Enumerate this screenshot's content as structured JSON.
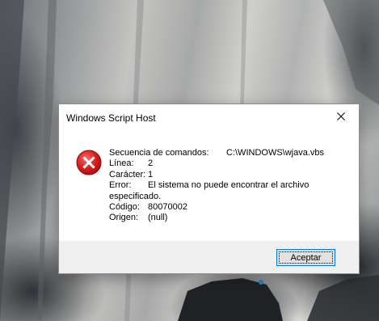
{
  "dialog": {
    "title": "Windows Script Host",
    "close_icon": "close-icon",
    "icon": "error-icon",
    "accent_color": "#0078d7",
    "error_color": "#e81123",
    "fields": {
      "script_label": "Secuencia de comandos:",
      "script_value": "C:\\WINDOWS\\wjava.vbs",
      "line_label": "Línea:",
      "line_value": "2",
      "char_label": "Carácter:",
      "char_value": "1",
      "error_label": "Error:",
      "error_value_1": "El sistema no puede encontrar el archivo",
      "error_value_2": "especificado.",
      "code_label": "Código:",
      "code_value": "80070002",
      "source_label": "Origen:",
      "source_value": "(null)"
    },
    "ok_label": "Aceptar"
  }
}
